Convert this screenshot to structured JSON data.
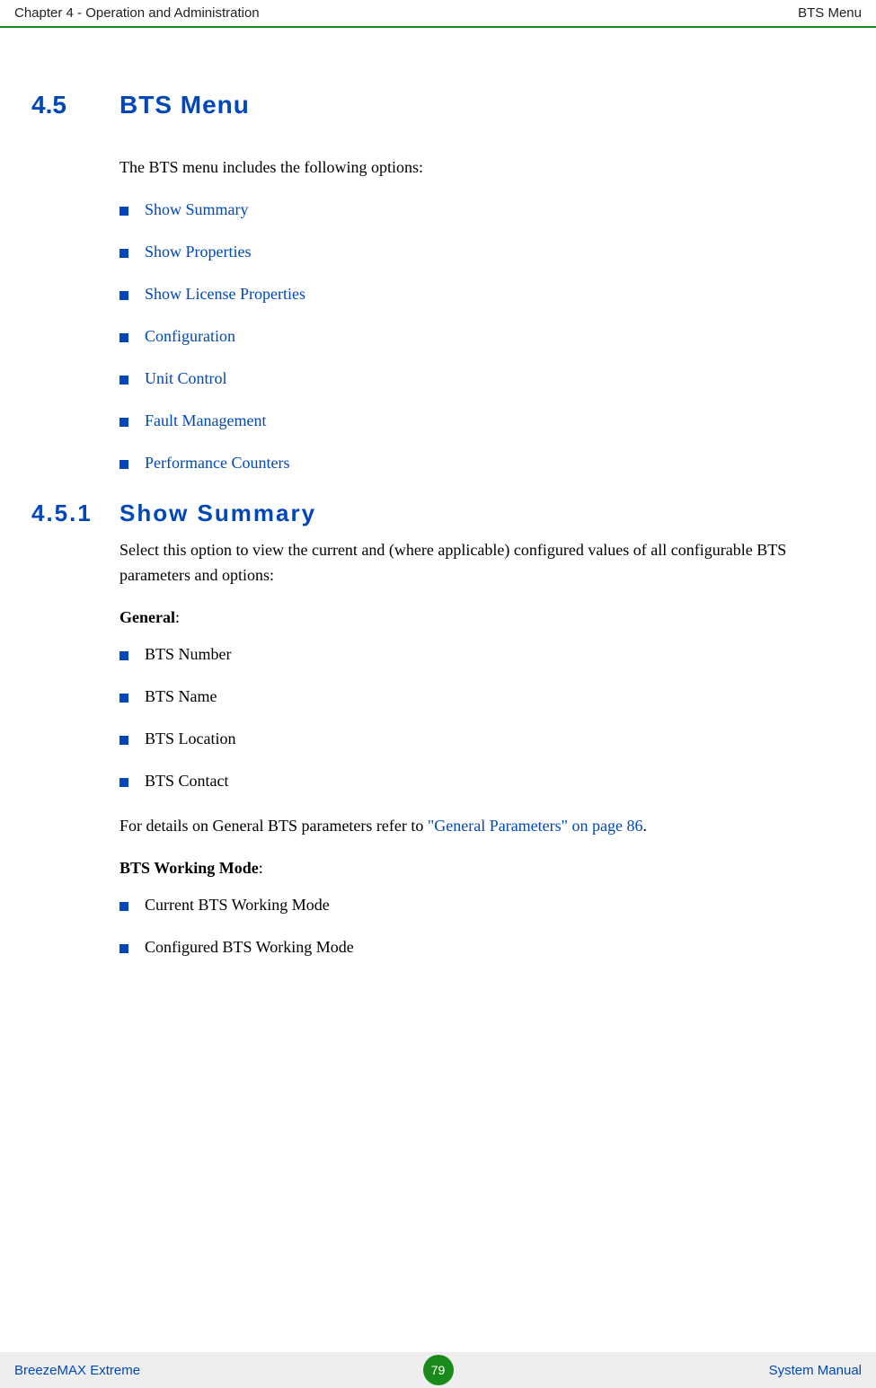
{
  "header": {
    "left": "Chapter 4 - Operation and Administration",
    "right": "BTS Menu"
  },
  "section": {
    "number": "4.5",
    "title": "BTS Menu",
    "intro": "The BTS menu includes the following options:",
    "options": [
      "Show Summary",
      "Show Properties",
      "Show License Properties",
      "Configuration",
      "Unit Control",
      "Fault Management",
      "Performance Counters"
    ]
  },
  "subsection": {
    "number": "4.5.1",
    "title": "Show Summary",
    "intro": "Select this option to view the current and (where applicable) configured values of all configurable BTS parameters and options:",
    "general_label": "General",
    "general_items": [
      "BTS Number",
      "BTS Name",
      "BTS Location",
      "BTS Contact"
    ],
    "general_ref_prefix": "For details on General BTS parameters refer to ",
    "general_ref_link": "\"General Parameters\" on page 86",
    "general_ref_suffix": ".",
    "working_mode_label": "BTS Working Mode",
    "working_mode_items": [
      "Current BTS Working Mode",
      "Configured BTS Working Mode"
    ]
  },
  "footer": {
    "left": "BreezeMAX Extreme",
    "page": "79",
    "right": "System Manual"
  }
}
